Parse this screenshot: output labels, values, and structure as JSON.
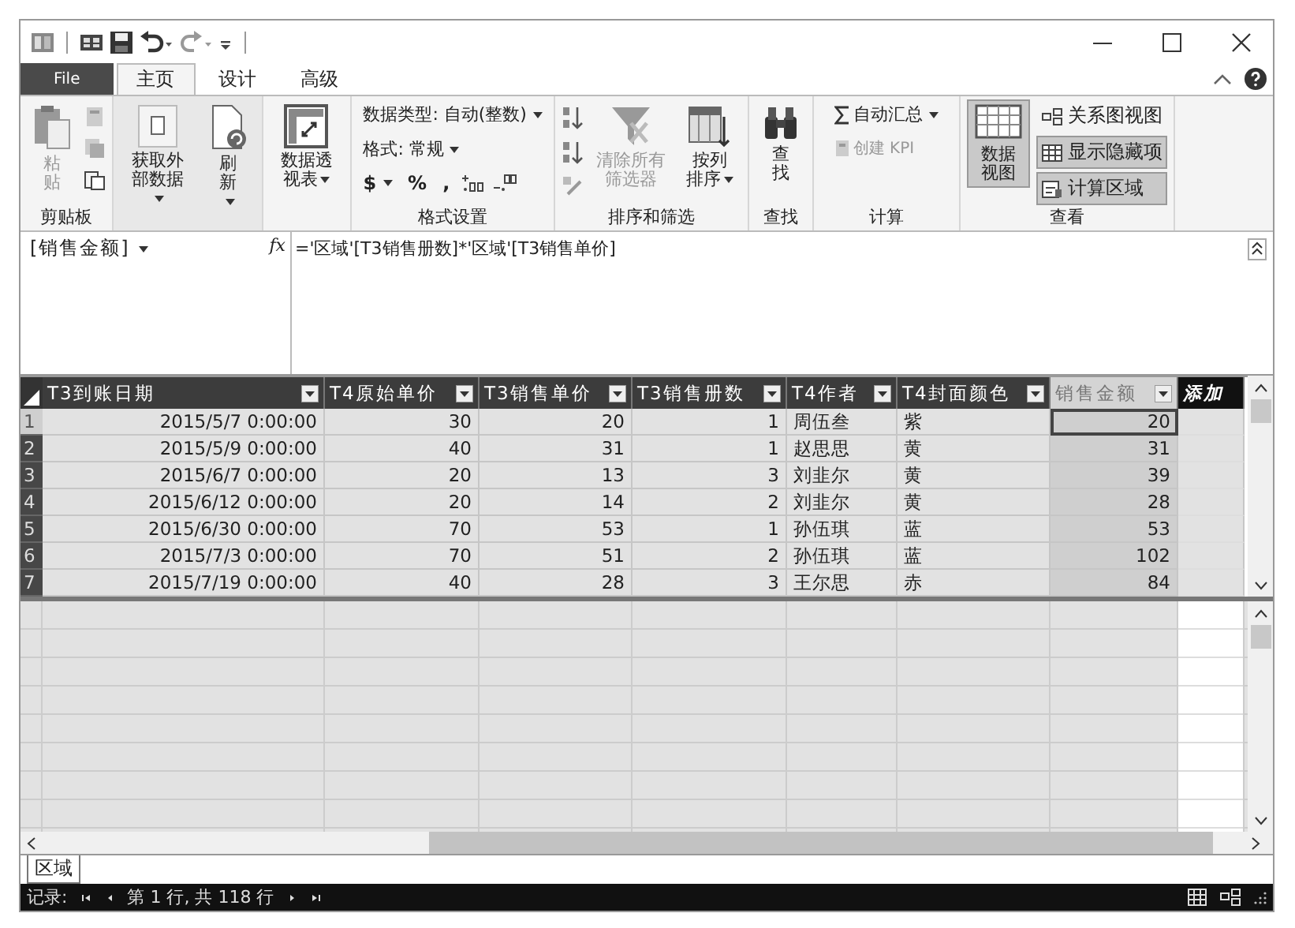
{
  "tabs": [
    {
      "label": "File",
      "kind": "file",
      "selected": false
    },
    {
      "label": "主页",
      "kind": "tab",
      "selected": true
    },
    {
      "label": "设计",
      "kind": "tab",
      "selected": false
    },
    {
      "label": "高级",
      "kind": "tab",
      "selected": false
    }
  ],
  "ribbon": {
    "clipboard": {
      "label": "剪贴板",
      "paste": {
        "label": "粘贴",
        "disabled": true
      }
    },
    "external": {
      "get_data": {
        "label": "获取外部数据",
        "dropdown": true
      },
      "refresh": {
        "label": "刷新",
        "dropdown": true
      }
    },
    "pivot": {
      "label": "数据透视表",
      "dropdown": true
    },
    "formatting": {
      "label": "格式设置",
      "data_type": "数据类型: 自动(整数)",
      "format": "格式: 常规",
      "currency": "$",
      "percent": "%",
      "comma": ","
    },
    "sort_filter": {
      "label": "排序和筛选",
      "clear_filters": {
        "label": "清除所有筛选器",
        "disabled": true
      },
      "sort_by_column": {
        "label": "按列排序",
        "disabled": false
      }
    },
    "find": {
      "label": "查找",
      "button": "查找"
    },
    "calculations": {
      "label": "计算",
      "autosum": {
        "label": "自动汇总",
        "disabled": false
      },
      "create_kpi": {
        "label": "创建 KPI",
        "disabled": true
      }
    },
    "view": {
      "label": "查看",
      "data_view": {
        "label": "数据视图",
        "selected": true
      },
      "diagram_view": {
        "label": "关系图视图",
        "selected": false
      },
      "show_hidden": {
        "label": "显示隐藏项",
        "selected": true
      },
      "calc_area": {
        "label": "计算区域",
        "selected": true
      }
    }
  },
  "formula_bar": {
    "name_box": "[销售金额]",
    "fx": "fx",
    "formula": "='区域'[T3销售册数]*'区域'[T3销售单价]"
  },
  "table": {
    "columns": [
      {
        "name": "T3到账日期",
        "kind": "date"
      },
      {
        "name": "T4原始单价",
        "kind": "number"
      },
      {
        "name": "T3销售单价",
        "kind": "number"
      },
      {
        "name": "T3销售册数",
        "kind": "number"
      },
      {
        "name": "T4作者",
        "kind": "text"
      },
      {
        "name": "T4封面颜色",
        "kind": "text"
      },
      {
        "name": "销售金额",
        "kind": "calculated"
      },
      {
        "name": "添加",
        "kind": "add"
      }
    ],
    "rows": [
      {
        "number": "1",
        "current": true,
        "cells": [
          "2015/5/7 0:00:00",
          "30",
          "20",
          "1",
          "周伍叁",
          "紫",
          "20"
        ]
      },
      {
        "number": "2",
        "current": false,
        "cells": [
          "2015/5/9 0:00:00",
          "40",
          "31",
          "1",
          "赵思思",
          "黄",
          "31"
        ]
      },
      {
        "number": "3",
        "current": false,
        "cells": [
          "2015/6/7 0:00:00",
          "20",
          "13",
          "3",
          "刘韭尔",
          "黄",
          "39"
        ]
      },
      {
        "number": "4",
        "current": false,
        "cells": [
          "2015/6/12 0:00:00",
          "20",
          "14",
          "2",
          "刘韭尔",
          "黄",
          "28"
        ]
      },
      {
        "number": "5",
        "current": false,
        "cells": [
          "2015/6/30 0:00:00",
          "70",
          "53",
          "1",
          "孙伍琪",
          "蓝",
          "53"
        ]
      },
      {
        "number": "6",
        "current": false,
        "cells": [
          "2015/7/3 0:00:00",
          "70",
          "51",
          "2",
          "孙伍琪",
          "蓝",
          "102"
        ]
      },
      {
        "number": "7",
        "current": false,
        "cells": [
          "2015/7/19 0:00:00",
          "40",
          "28",
          "3",
          "王尔思",
          "赤",
          "84"
        ]
      }
    ]
  },
  "sheet_tabs": [
    {
      "label": "区域",
      "selected": true
    }
  ],
  "status_bar": {
    "record_label": "记录:",
    "position": "第 1 行, 共 118 行"
  }
}
